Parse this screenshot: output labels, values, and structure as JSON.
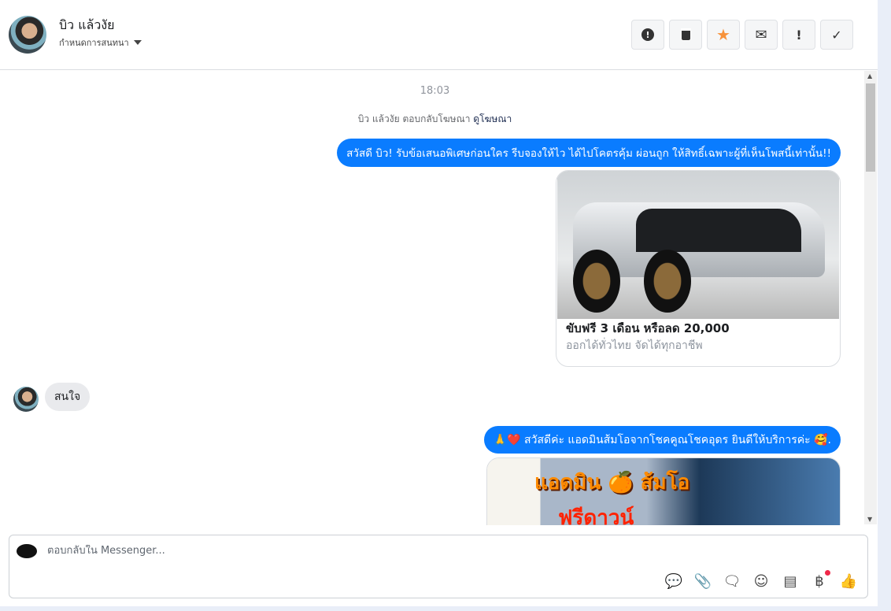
{
  "header": {
    "name": "บิว แล้วงัย",
    "subtitle": "กำหนดการสนทนา",
    "actions": [
      {
        "icon": "alert-circle-icon",
        "glyph": "❗"
      },
      {
        "icon": "trash-icon",
        "glyph": "🗑"
      },
      {
        "icon": "star-icon",
        "glyph": "★"
      },
      {
        "icon": "envelope-icon",
        "glyph": "✉"
      },
      {
        "icon": "exclamation-icon",
        "glyph": "!"
      },
      {
        "icon": "check-icon",
        "glyph": "✓"
      }
    ]
  },
  "chat": {
    "timestamp": "18:03",
    "ad_reply_text": "บิว แล้วงัย ตอบกลับโฆษณา",
    "ad_link": "ดูโฆษณา",
    "messages": [
      {
        "text": "สวัสดี บิว! รับข้อเสนอพิเศษก่อนใคร รีบจองให้ไว ได้ไปโคตรคุ้ม ผ่อนถูก ให้สิทธิ์เฉพาะผู้ที่เห็นโพสนี้เท่านั้น!!"
      },
      {
        "card_title": "ขับฟรี 3 เดือน หรือลด 20,000",
        "card_subtitle": "ออกได้ทั่วไทย จัดได้ทุกอาชีพ"
      },
      {
        "text": "สนใจ"
      },
      {
        "text": "🙏❤️ สวัสดีค่ะ แอดมินส้มโอจากโชคคูณโชคอุดร ยินดีให้บริการค่ะ 🥰."
      },
      {
        "banner_text": "แอดมิน 🍊 ส้มโอ",
        "banner_text2": "ฟรีดาวน์"
      }
    ]
  },
  "composer": {
    "placeholder": "ตอบกลับใน Messenger..."
  },
  "colors": {
    "accent": "#0a7cff",
    "incoming": "#e9eaed",
    "star": "#f7923a"
  }
}
